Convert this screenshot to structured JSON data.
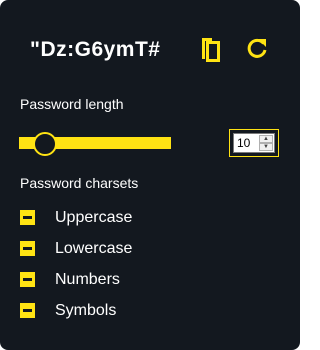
{
  "password": {
    "value": "\"Dz:G6ymT#"
  },
  "actions": {
    "copy_icon": "copy-icon",
    "refresh_icon": "refresh-icon"
  },
  "length": {
    "label": "Password length",
    "value": "10",
    "min": 4,
    "max": 32,
    "slider_fraction": 0.16
  },
  "charsets": {
    "label": "Password charsets",
    "items": [
      {
        "label": "Uppercase"
      },
      {
        "label": "Lowercase"
      },
      {
        "label": "Numbers"
      },
      {
        "label": "Symbols"
      }
    ]
  },
  "colors": {
    "background": "#13181f",
    "accent": "#ffe313",
    "text": "#ffffff"
  }
}
